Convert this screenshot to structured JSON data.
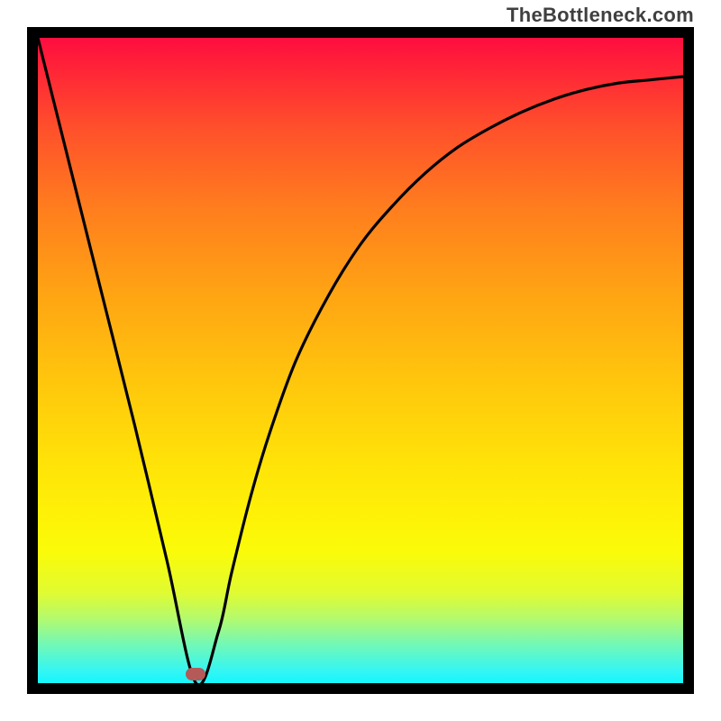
{
  "watermark": "TheBottleneck.com",
  "gradient_css": "linear-gradient(to bottom, #fe0d40 0%, #ff2038 4%, #ff502b 14%, #ff7c1e 26%, #ffa513 40%, #ffc80c 54%, #ffe308 66%, #fdf507 76%, #f9fb0a 80%, #e0fb32 86%, #b3fa6e 90%, #72f8b7 94%, #35f6f2 98%, #15f6ff 100%)",
  "marker": {
    "color": "#b45a58",
    "x_frac": 0.245,
    "y_frac": 0.986
  },
  "chart_data": {
    "type": "line",
    "title": "",
    "xlabel": "",
    "ylabel": "",
    "xlim": [
      0,
      1
    ],
    "ylim": [
      0,
      1
    ],
    "series": [
      {
        "name": "bottleneck-curve",
        "x": [
          0.0,
          0.05,
          0.1,
          0.15,
          0.2,
          0.245,
          0.28,
          0.3,
          0.33,
          0.36,
          0.4,
          0.45,
          0.5,
          0.55,
          0.6,
          0.65,
          0.7,
          0.75,
          0.8,
          0.85,
          0.9,
          0.95,
          1.0
        ],
        "y": [
          1.0,
          0.8,
          0.6,
          0.4,
          0.19,
          0.0,
          0.08,
          0.17,
          0.29,
          0.39,
          0.5,
          0.6,
          0.68,
          0.74,
          0.79,
          0.83,
          0.86,
          0.885,
          0.905,
          0.92,
          0.93,
          0.935,
          0.94
        ]
      }
    ],
    "marker": {
      "x": 0.245,
      "y": 0.0
    },
    "background_gradient": {
      "direction": "top-to-bottom",
      "stops": [
        {
          "pos": 0.0,
          "color": "#fe0d40"
        },
        {
          "pos": 0.25,
          "color": "#ff7a1f"
        },
        {
          "pos": 0.55,
          "color": "#ffc80c"
        },
        {
          "pos": 0.78,
          "color": "#fbf808"
        },
        {
          "pos": 0.9,
          "color": "#9cfa83"
        },
        {
          "pos": 1.0,
          "color": "#15f6ff"
        }
      ]
    }
  }
}
